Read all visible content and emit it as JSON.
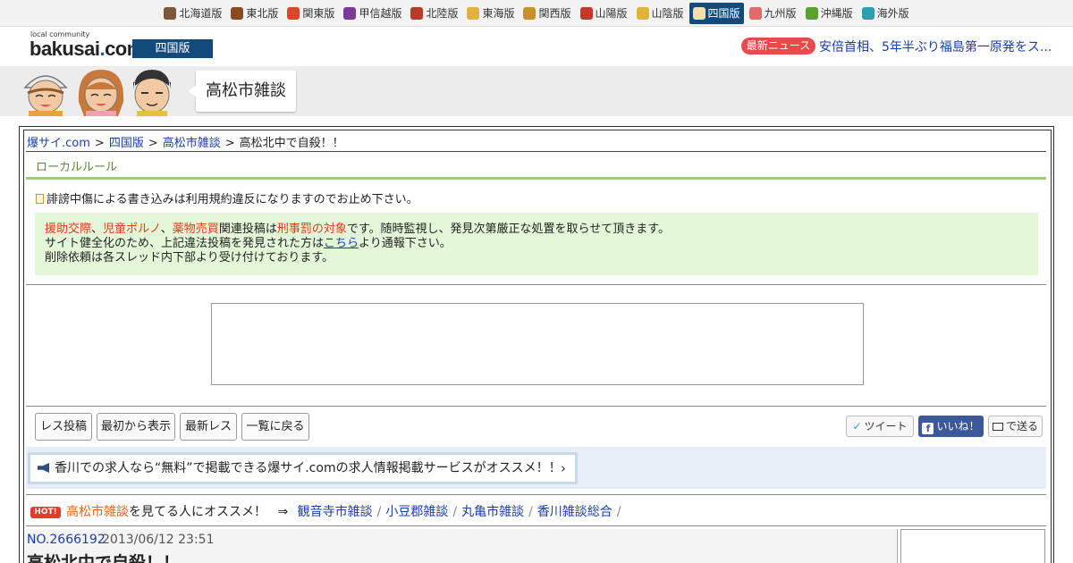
{
  "regions": [
    {
      "label": "北海道版",
      "icon": "hokkaido-icon",
      "color": "#7a5a3a",
      "active": false
    },
    {
      "label": "東北版",
      "icon": "tohoku-icon",
      "color": "#8a4a20",
      "active": false
    },
    {
      "label": "関東版",
      "icon": "kanto-icon",
      "color": "#d9472b",
      "active": false
    },
    {
      "label": "甲信越版",
      "icon": "koshinetsu-icon",
      "color": "#7a3a9a",
      "active": false
    },
    {
      "label": "北陸版",
      "icon": "hokuriku-icon",
      "color": "#b83a2a",
      "active": false
    },
    {
      "label": "東海版",
      "icon": "tokai-icon",
      "color": "#e0b040",
      "active": false
    },
    {
      "label": "関西版",
      "icon": "kansai-icon",
      "color": "#c8902a",
      "active": false
    },
    {
      "label": "山陽版",
      "icon": "sanyo-icon",
      "color": "#c0392b",
      "active": false
    },
    {
      "label": "山陰版",
      "icon": "sanin-icon",
      "color": "#e0b040",
      "active": false
    },
    {
      "label": "四国版",
      "icon": "shikoku-icon",
      "color": "#f0e0b0",
      "active": true
    },
    {
      "label": "九州版",
      "icon": "kyushu-icon",
      "color": "#e06a6a",
      "active": false
    },
    {
      "label": "沖縄版",
      "icon": "okinawa-icon",
      "color": "#5aa030",
      "active": false
    },
    {
      "label": "海外版",
      "icon": "overseas-icon",
      "color": "#2aa0b0",
      "active": false
    }
  ],
  "header": {
    "logo_small": "local community",
    "logo_name": "bakusai",
    "logo_dot": ".",
    "logo_tld": "com",
    "edition": "四国版",
    "news_badge": "最新ニュース",
    "news_text": "安倍首相、5年半ぶり福島第一原発をス..."
  },
  "banner": {
    "board_name": "高松市雑談"
  },
  "breadcrumb": {
    "items": [
      "爆サイ.com",
      "四国版",
      "高松市雑談"
    ],
    "current": "高松北中で自殺！！",
    "separator": ">"
  },
  "rules": {
    "title": "ローカルルール",
    "warning": "誹謗中傷による書き込みは利用規約違反になりますのでお止め下さい。",
    "notice_red_1": "援助交際",
    "notice_red_2": "児童ポルノ",
    "notice_red_3": "薬物売買",
    "notice_sep": "、",
    "notice_mid": "関連投稿は",
    "notice_red_4": "刑事罰の対象",
    "notice_end": "です。随時監視し、発見次第厳正な処置を取らせて頂きます。",
    "notice_line2_pre": "サイト健全化のため、上記違法投稿を発見された方は",
    "notice_line2_link": "こちら",
    "notice_line2_post": "より通報下さい。",
    "notice_line3": "削除依頼は各スレッド内下部より受け付けております。"
  },
  "actions": {
    "post_reply": "レス投稿",
    "show_from_start": "最初から表示",
    "latest_replies": "最新レス",
    "back_to_list": "一覧に戻る",
    "tweet": "ツイート",
    "like": "いいね！",
    "send": "で送る"
  },
  "promo": {
    "text": "香川での求人なら“無料”で掲載できる爆サイ.comの求人情報掲載サービスがオススメ！！",
    "chevron": "›"
  },
  "recommend": {
    "hot_label": "HOT!",
    "board": "高松市雑談",
    "lead": "を見てる人にオススメ！",
    "arrow": "⇒",
    "links": [
      "観音寺市雑談",
      "小豆郡雑談",
      "丸亀市雑談",
      "香川雑談総合"
    ],
    "slash": "/"
  },
  "post": {
    "number": "NO.2666192",
    "date": "2013/06/12 23:51",
    "title": "高松北中で自殺！！"
  }
}
